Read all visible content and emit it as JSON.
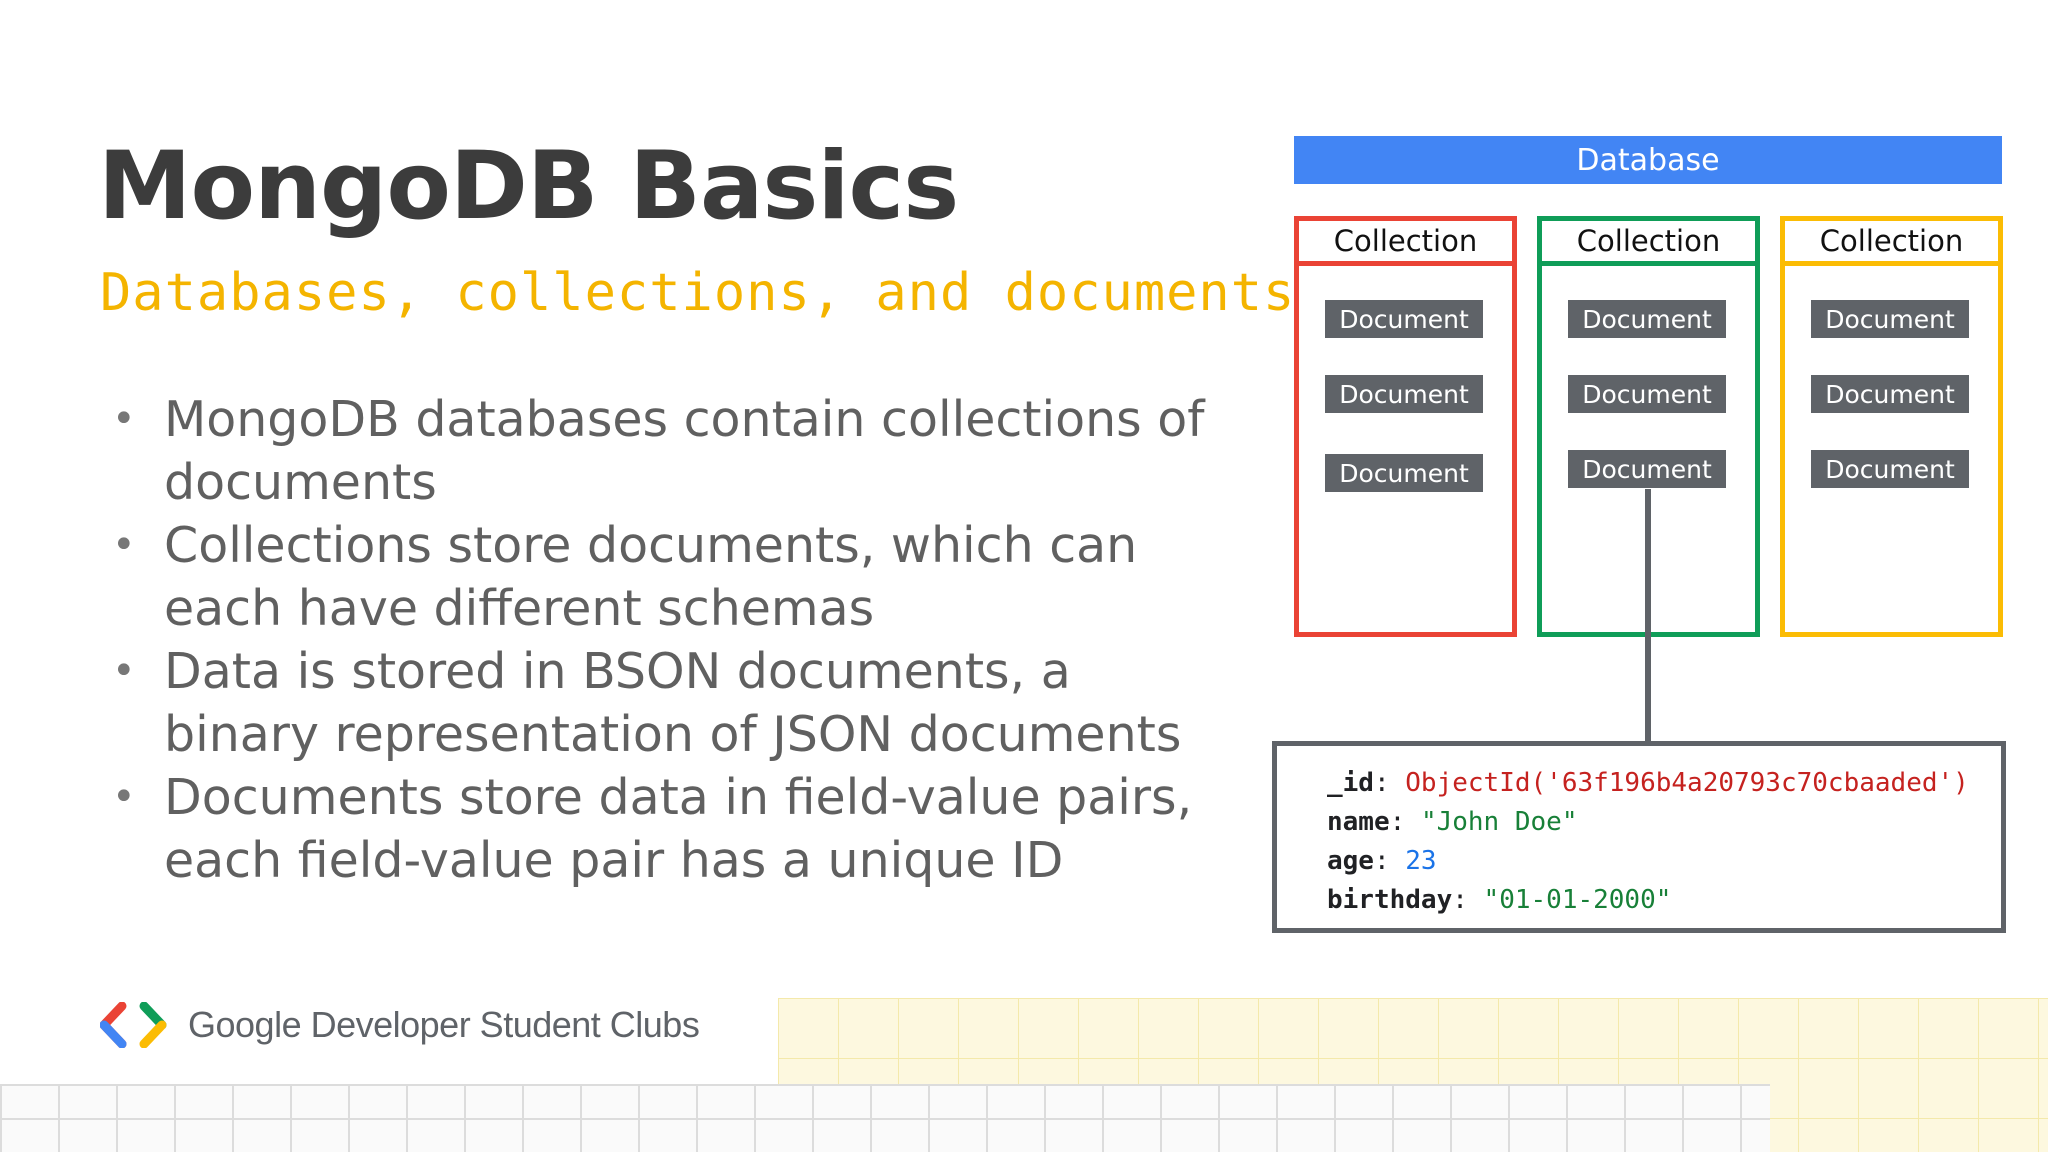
{
  "slide": {
    "title": "MongoDB Basics",
    "subtitle": "Databases, collections, and documents",
    "bullets": [
      "MongoDB databases contain collections of documents",
      "Collections store documents, which can each have different schemas",
      "Data is stored in BSON documents, a binary representation of JSON documents",
      "Documents store data in field-value pairs, each field-value pair has a unique ID"
    ],
    "bullet_glyph": "•"
  },
  "diagram": {
    "database_label": "Database",
    "collections": [
      {
        "label": "Collection",
        "color": "#ea4335",
        "documents": [
          "Document",
          "Document",
          "Document"
        ]
      },
      {
        "label": "Collection",
        "color": "#0f9d58",
        "documents": [
          "Document",
          "Document",
          "Document"
        ]
      },
      {
        "label": "Collection",
        "color": "#fbbc04",
        "documents": [
          "Document",
          "Document",
          "Document"
        ]
      }
    ],
    "document_example": {
      "fields": [
        {
          "key": "_id",
          "value": "ObjectId('63f196b4a20793c70cbaaded')",
          "kind": "oid"
        },
        {
          "key": "name",
          "value": "\"John Doe\"",
          "kind": "str"
        },
        {
          "key": "age",
          "value": "23",
          "kind": "num"
        },
        {
          "key": "birthday",
          "value": "\"01-01-2000\"",
          "kind": "str"
        }
      ]
    },
    "colors": {
      "database": "#4285f4",
      "document": "#5f6368"
    }
  },
  "footer": {
    "brand": "Google Developer Student Clubs"
  }
}
